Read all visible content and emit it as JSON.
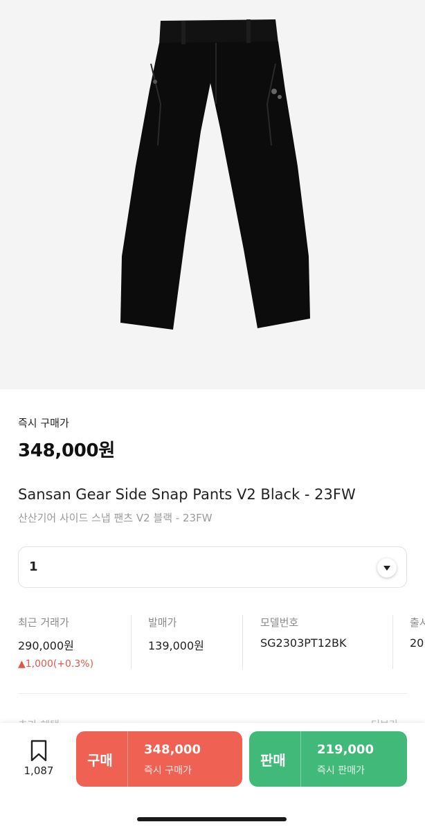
{
  "product": {
    "image_alt": "black pants",
    "instant_buy_label": "즉시 구매가",
    "instant_buy_price": "348,000원",
    "title_en": "Sansan Gear Side Snap Pants V2 Black - 23FW",
    "title_ko": "산산기어 사이드 스냅 팬츠 V2 블랙 - 23FW"
  },
  "size_select": {
    "value": "1",
    "icon": "chevron-down-icon"
  },
  "info": {
    "recent": {
      "label": "최근 거래가",
      "value": "290,000원",
      "change": "▲1,000(+0.3%)"
    },
    "release_price": {
      "label": "발매가",
      "value": "139,000원"
    },
    "model_no": {
      "label": "모델번호",
      "value": "SG2303PT12BK"
    },
    "release_date": {
      "label": "출시",
      "value": "20"
    }
  },
  "below_fold": {
    "left": "추가 혜택",
    "right": "더보기"
  },
  "bottom_bar": {
    "bookmark_count": "1,087",
    "buy": {
      "label": "구매",
      "amount": "348,000",
      "sub": "즉시 구매가"
    },
    "sell": {
      "label": "판매",
      "amount": "219,000",
      "sub": "즉시 판매가"
    }
  },
  "colors": {
    "buy": "#ef6253",
    "sell": "#41b979",
    "price_up": "#e0574a"
  }
}
